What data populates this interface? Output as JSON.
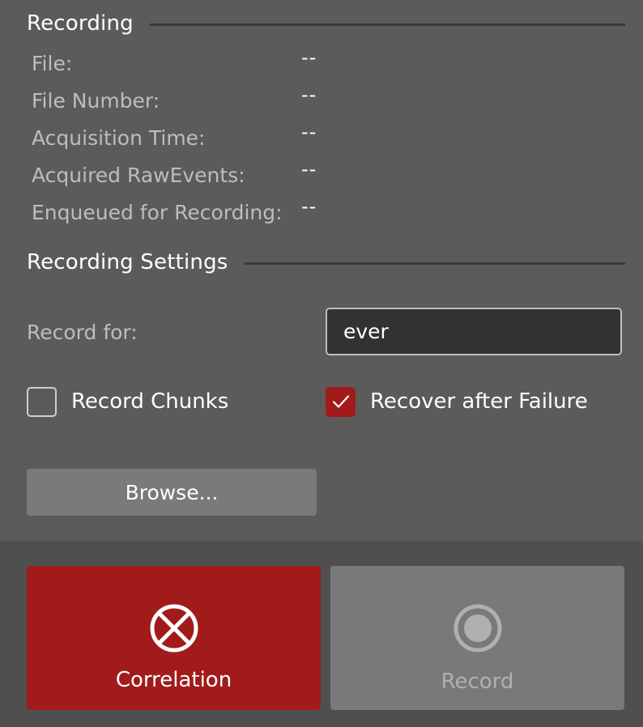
{
  "recording": {
    "title": "Recording",
    "rows": [
      {
        "label": "File:",
        "value": "--"
      },
      {
        "label": "File Number:",
        "value": "--"
      },
      {
        "label": "Acquisition Time:",
        "value": "--"
      },
      {
        "label": "Acquired RawEvents:",
        "value": "--"
      },
      {
        "label": "Enqueued for Recording:",
        "value": "--"
      }
    ]
  },
  "settings": {
    "title": "Recording Settings",
    "record_for_label": "Record for:",
    "record_for_value": "ever",
    "record_chunks": {
      "label": "Record Chunks",
      "checked": false
    },
    "recover_after_failure": {
      "label": "Recover after Failure",
      "checked": true
    },
    "browse_label": "Browse..."
  },
  "actions": {
    "correlation": {
      "label": "Correlation",
      "icon": "circle-x-icon"
    },
    "record": {
      "label": "Record",
      "icon": "record-icon"
    }
  },
  "colors": {
    "accent": "#a11b1b",
    "panel": "#5b5b5b",
    "bottom_bar": "#4f4f4f",
    "disabled_button": "#797979"
  }
}
